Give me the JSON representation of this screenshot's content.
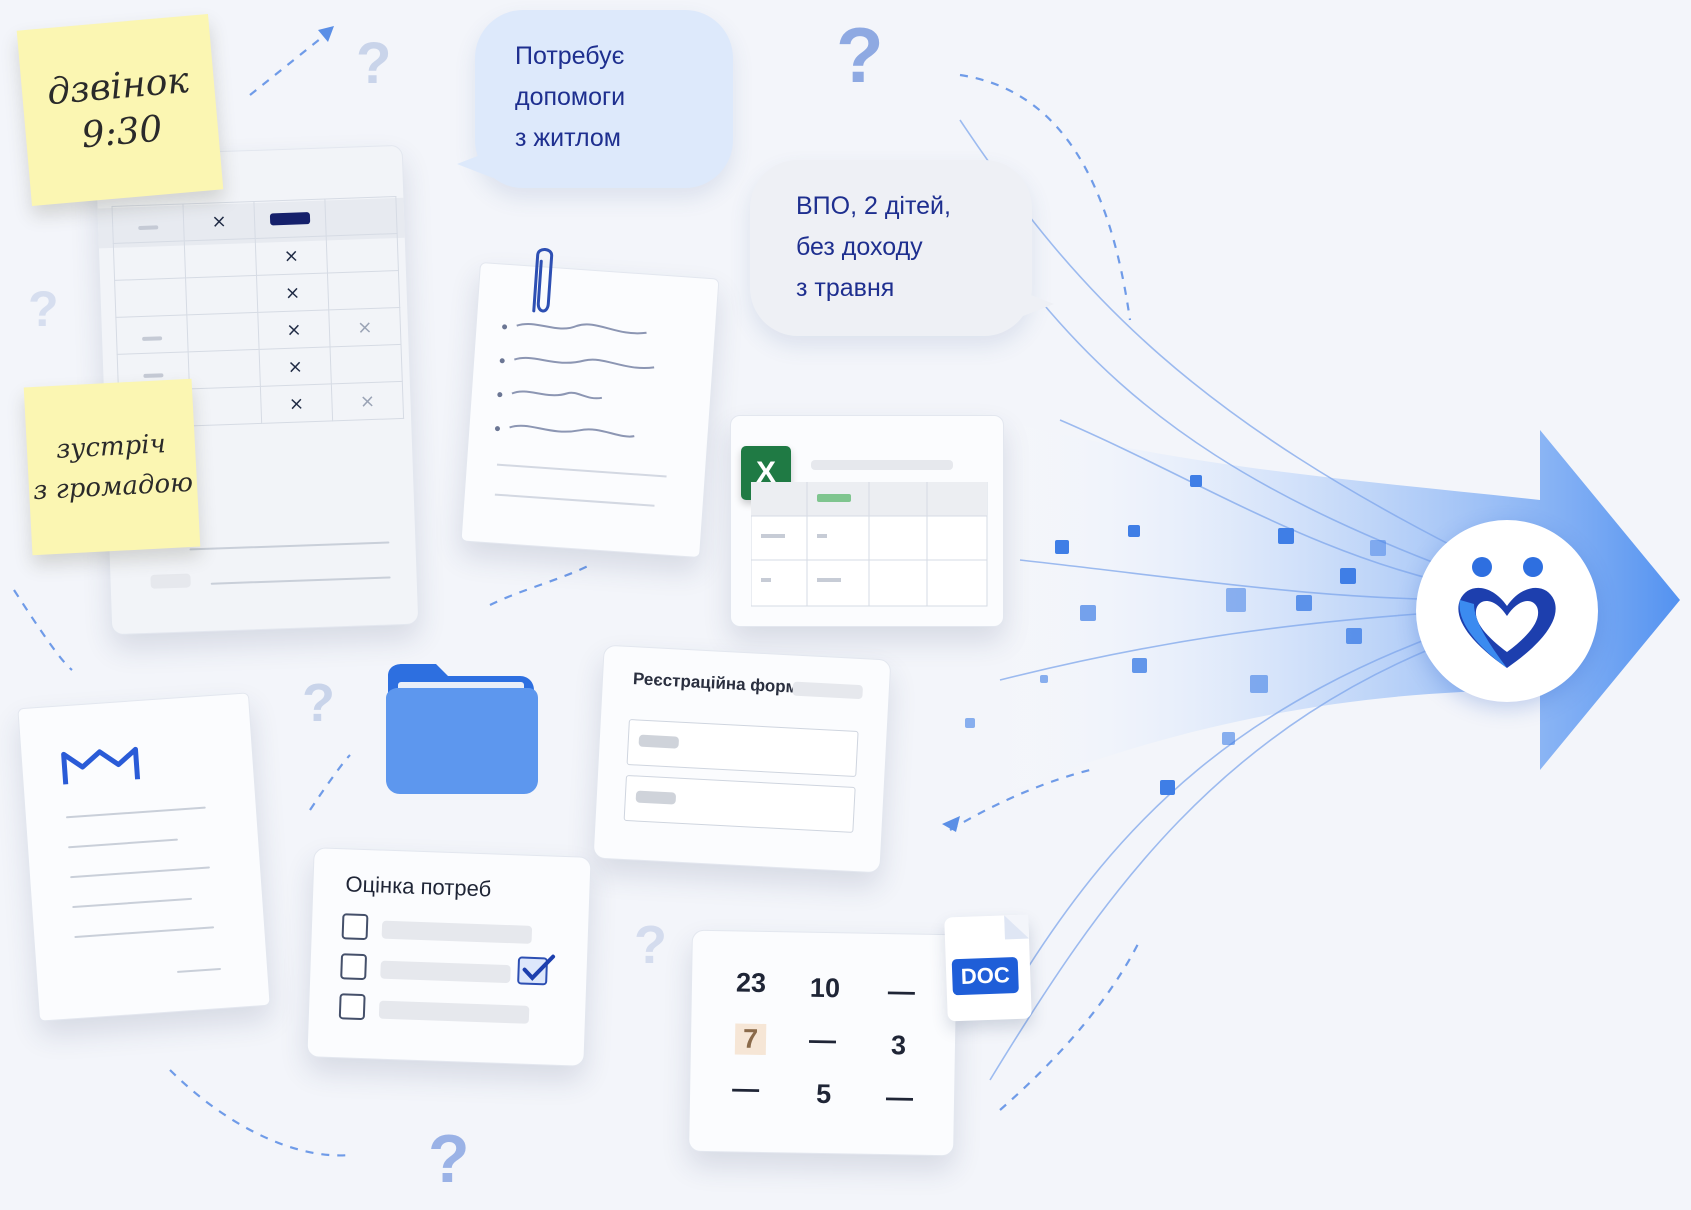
{
  "notes": {
    "call": {
      "line1": "дзвінок",
      "line2": "9:30"
    },
    "meeting": {
      "line1": "зустріч",
      "line2": "з громадою"
    }
  },
  "bubbles": {
    "housing": [
      "Потребує",
      "допомоги",
      "з житлом"
    ],
    "idp": [
      "ВПО, 2 дітей,",
      "без доходу",
      "з травня"
    ]
  },
  "spreadsheet": {
    "rows": [
      [
        "x",
        "bar",
        ""
      ],
      [
        "",
        "x",
        ""
      ],
      [
        "",
        "x",
        ""
      ],
      [
        "",
        "x",
        "x"
      ],
      [
        "",
        "x",
        ""
      ],
      [
        "",
        "x",
        "x"
      ]
    ],
    "mark": "×"
  },
  "excel": {
    "badge": "X"
  },
  "registration_form": {
    "title": "Реєстраційна форма"
  },
  "needs_assessment": {
    "title": "Оцінка потреб",
    "checked_row": 2
  },
  "numbers_card": {
    "row1": [
      "23",
      "10",
      "—"
    ],
    "row2": [
      "7",
      "—",
      "3"
    ],
    "row3": [
      "—",
      "5",
      "—"
    ]
  },
  "doc_badge": "DOC",
  "question_mark": "?",
  "colors": {
    "accent_blue": "#3b7de6",
    "deep_blue": "#1d3fae",
    "sticky_yellow": "#fbf6b2",
    "excel_green": "#1f7a44",
    "bubble_light": "#dde9fb",
    "bubble_grey": "#eef0f5"
  },
  "icons": [
    "paperclip-icon",
    "folder-icon",
    "mail-logo-icon",
    "checkmark-icon",
    "heart-people-logo-icon",
    "arrow-icon"
  ]
}
